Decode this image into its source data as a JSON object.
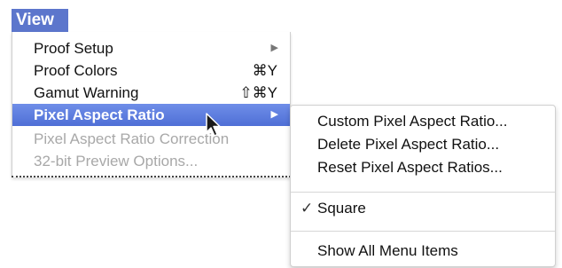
{
  "menu": {
    "title": "View",
    "items": [
      {
        "label": "Proof Setup",
        "shortcut": "",
        "has_submenu": true
      },
      {
        "label": "Proof Colors",
        "shortcut": "⌘Y"
      },
      {
        "label": "Gamut Warning",
        "shortcut": "⇧⌘Y"
      },
      {
        "label": "Pixel Aspect Ratio",
        "has_submenu": true,
        "highlighted": true
      },
      {
        "label": "Pixel Aspect Ratio Correction",
        "disabled": true
      },
      {
        "label": "32-bit Preview Options...",
        "disabled": true
      }
    ],
    "submenu_arrow_glyph": "▶"
  },
  "submenu": {
    "items": [
      {
        "label": "Custom Pixel Aspect Ratio..."
      },
      {
        "label": "Delete Pixel Aspect Ratio..."
      },
      {
        "label": "Reset Pixel Aspect Ratios..."
      },
      {
        "label": "Square",
        "checked": true
      },
      {
        "label": "Show All Menu Items"
      }
    ],
    "check_glyph": "✓"
  },
  "colors": {
    "highlight": "#5c76cc",
    "disabled_text": "#a8a8a8"
  },
  "icons": {
    "cursor": "arrow-pointer-icon"
  }
}
